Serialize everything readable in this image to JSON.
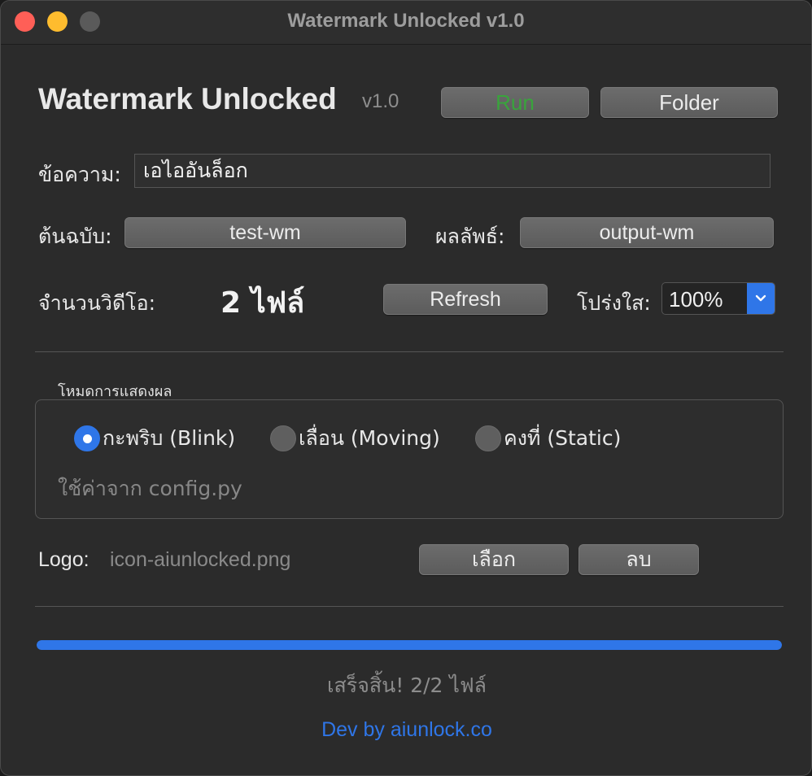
{
  "window": {
    "title": "Watermark Unlocked v1.0"
  },
  "header": {
    "app_title": "Watermark Unlocked",
    "version": "v1.0",
    "run_label": "Run",
    "run_color": "#39a43c",
    "folder_label": "Folder"
  },
  "message": {
    "label": "ข้อความ:",
    "value": "เอไออันล็อก"
  },
  "paths": {
    "source_label": "ต้นฉบับ:",
    "source_value": "test-wm",
    "output_label": "ผลลัพธ์:",
    "output_value": "output-wm"
  },
  "videos": {
    "count_label": "จำนวนวิดีโอ:",
    "count_value": "2 ไฟล์",
    "refresh_label": "Refresh"
  },
  "opacity": {
    "label": "โปร่งใส:",
    "selected": "100%"
  },
  "display_mode": {
    "title": "โหมดการแสดงผล",
    "options": [
      {
        "label": "กะพริบ (Blink)",
        "selected": true
      },
      {
        "label": "เลื่อน (Moving)",
        "selected": false
      },
      {
        "label": "คงที่ (Static)",
        "selected": false
      }
    ],
    "hint": "ใช้ค่าจาก config.py"
  },
  "logo": {
    "label": "Logo:",
    "file": "icon-aiunlocked.png",
    "choose_label": "เลือก",
    "delete_label": "ลบ"
  },
  "progress": {
    "fraction": 1.0,
    "status": "เสร็จสิ้น! 2/2 ไฟล์"
  },
  "footer": {
    "dev_text": "Dev by aiunlock.co"
  },
  "colors": {
    "accent": "#2f76e8",
    "run_text": "#39a43c",
    "close": "#ff5f57",
    "minimize": "#febc2e"
  }
}
